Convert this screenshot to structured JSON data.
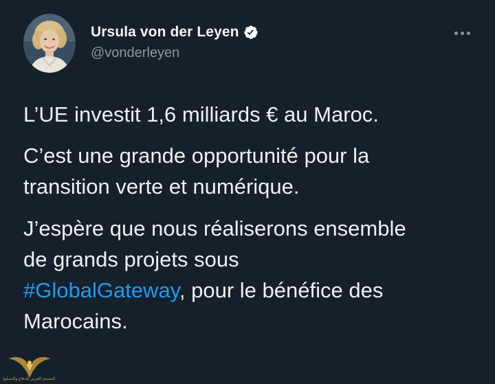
{
  "tweet": {
    "author": {
      "display_name": "Ursula von der Leyen",
      "handle": "@vonderleyen",
      "verified": true,
      "avatar_icon": "profile-photo"
    },
    "more_icon": "ellipsis-icon",
    "text": {
      "para1": "L’UE investit 1,6 milliards € au Maroc.",
      "para2_line1": "C’est une grande opportunité pour la",
      "para2_line2": "transition verte et numérique.",
      "para3_line1": "J’espère que nous réaliserons ensemble",
      "para3_line2": "de grands projets sous",
      "hashtag": "#GlobalGateway",
      "para3_line3_rest": ", pour le bénéfice des",
      "para3_line4": "Marocains."
    }
  },
  "watermark": {
    "text": "المنتدى العربي للدفاع والتسليح"
  },
  "colors": {
    "background": "#15202b",
    "text": "#eef1f3",
    "secondary_text": "#8b98a5",
    "hashtag": "#1d9bf0",
    "verified_badge": "#ffffff"
  }
}
